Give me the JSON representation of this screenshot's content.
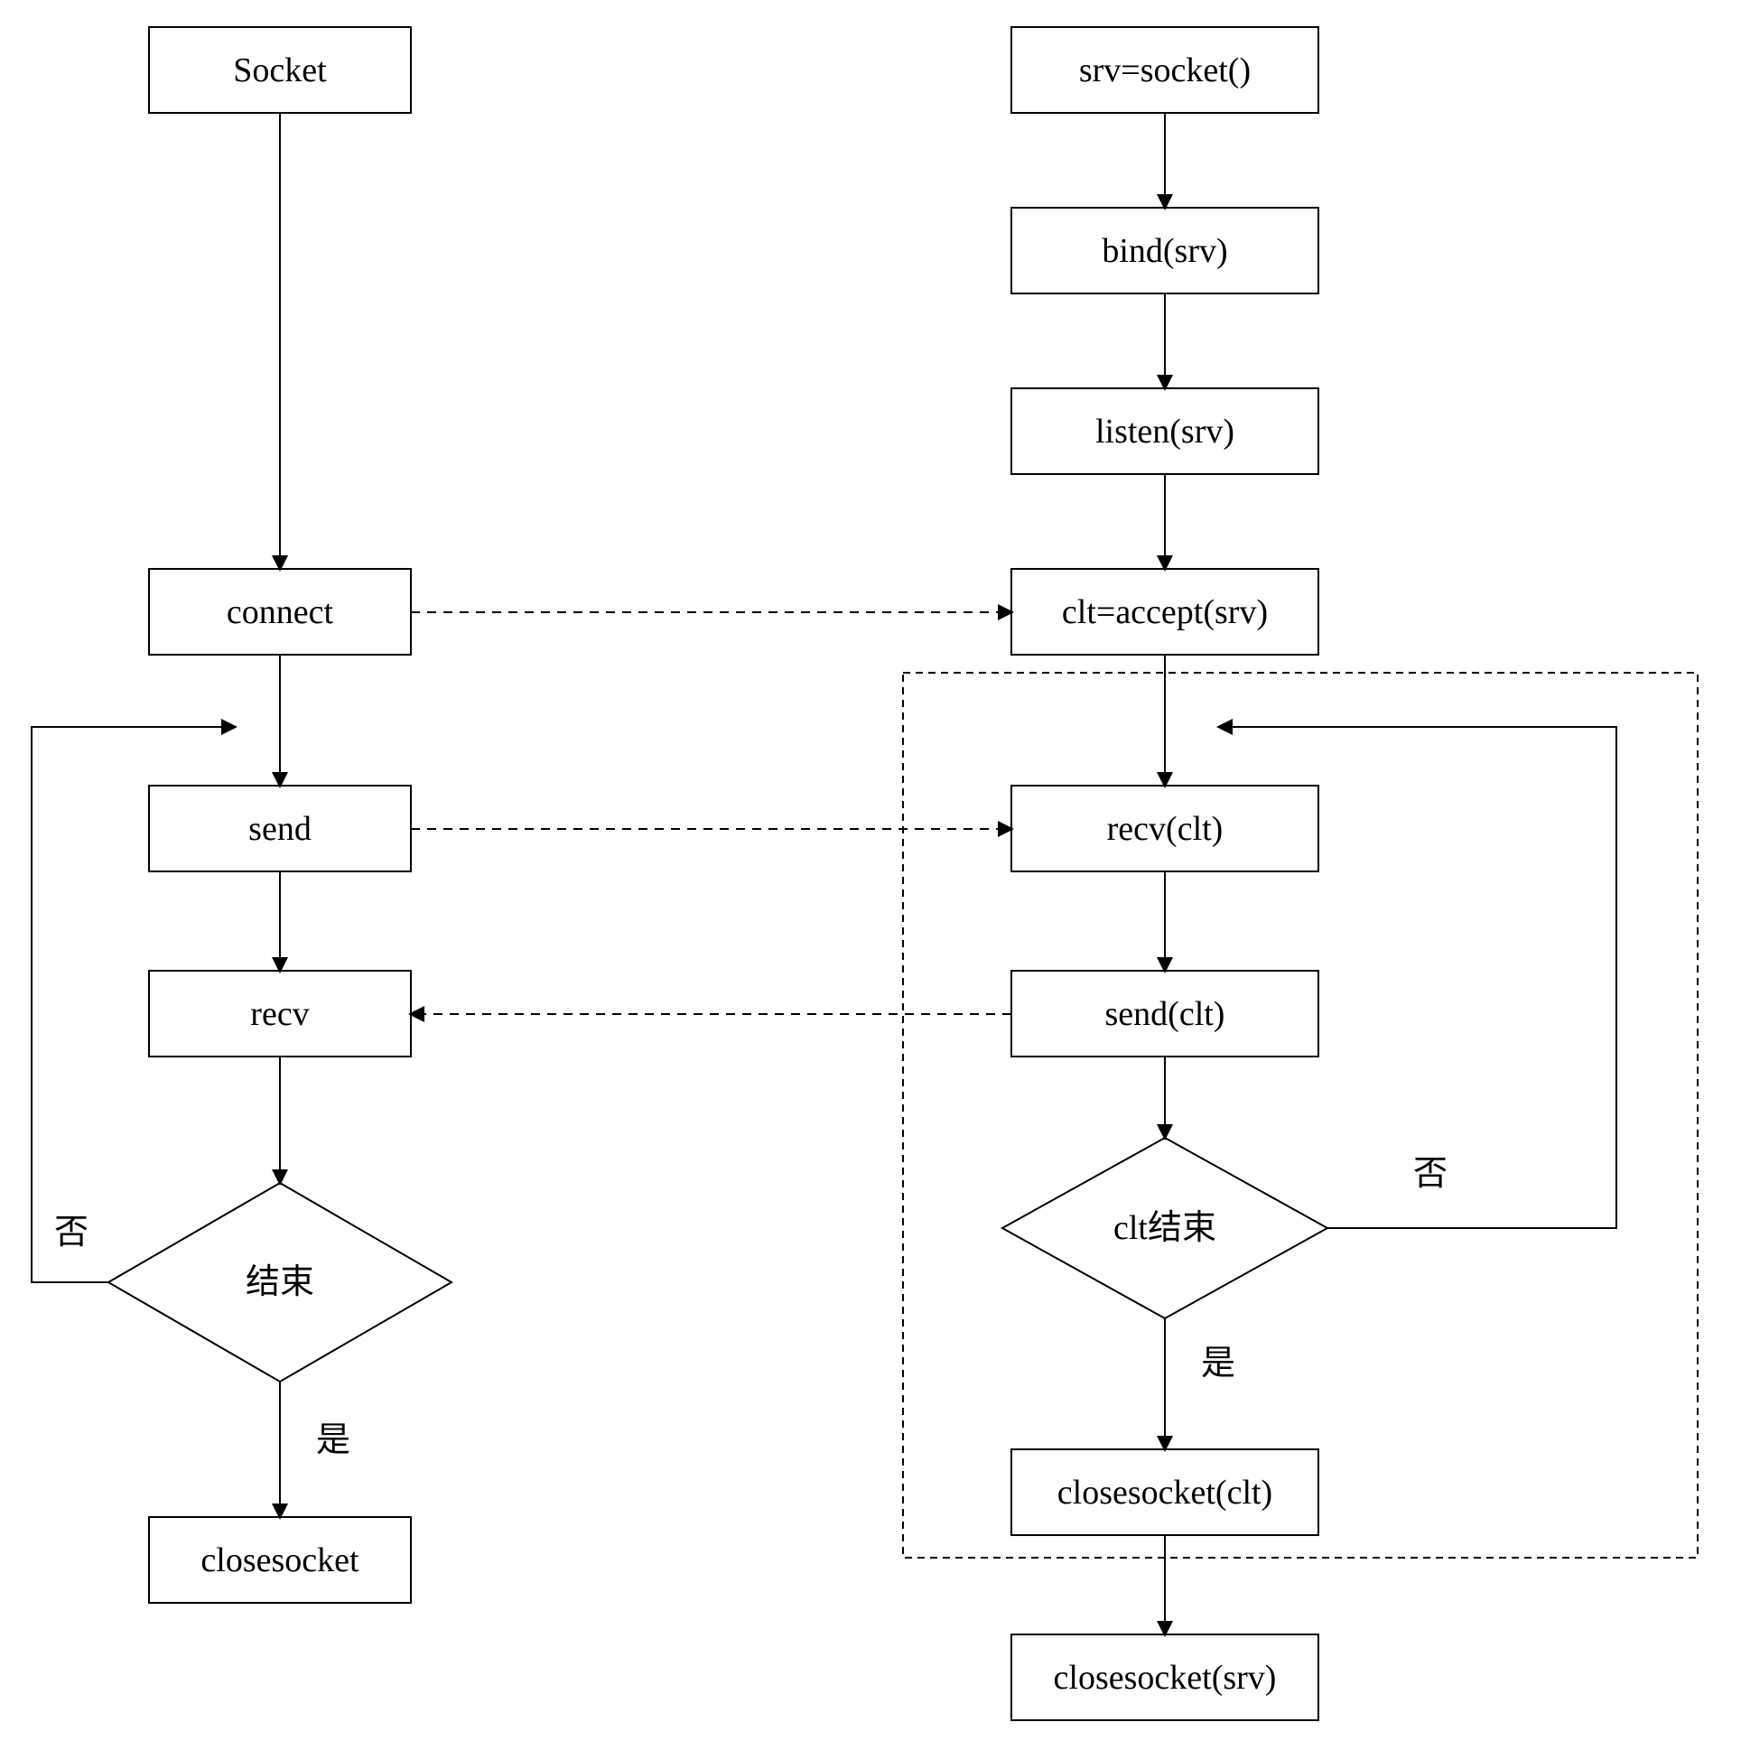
{
  "client": {
    "socket": "Socket",
    "connect": "connect",
    "send": "send",
    "recv": "recv",
    "decision": "结束",
    "no": "否",
    "yes": "是",
    "close": "closesocket"
  },
  "server": {
    "socket": "srv=socket()",
    "bind": "bind(srv)",
    "listen": "listen(srv)",
    "accept": "clt=accept(srv)",
    "recv": "recv(clt)",
    "send": "send(clt)",
    "decision": "clt结束",
    "no": "否",
    "yes": "是",
    "close_clt": "closesocket(clt)",
    "close_srv": "closesocket(srv)"
  }
}
